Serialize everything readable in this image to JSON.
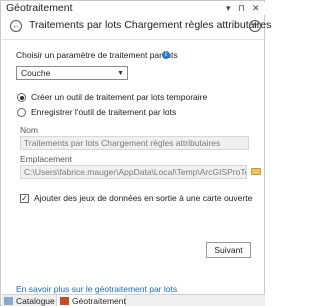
{
  "window": {
    "title": "Géotraitement",
    "controls": {
      "pin": "▾",
      "autohide": "⊓",
      "close": "✕"
    }
  },
  "header": {
    "back_icon": "←",
    "title": "Traitements par lots Chargement règles attributaires",
    "add_icon": "+"
  },
  "form": {
    "param_label": "Choisir un paramètre de traitement par lots",
    "info_icon": "i",
    "param_value": "Couche",
    "radio_temp": "Créer un outil de traitement par lots temporaire",
    "radio_save": "Enregistrer l'outil de traitement par lots",
    "name_label": "Nom",
    "name_value": "Traitements par lots Chargement règles attributaires",
    "location_label": "Emplacement",
    "location_value": "C:\\Users\\fabrice.mauger\\AppData\\Local\\Temp\\ArcGISProTemp218",
    "add_outputs_label": "Ajouter des jeux de données en sortie à une carte ouverte",
    "add_outputs_checked": true,
    "next_button": "Suivant"
  },
  "footer": {
    "learn_more_link": "En savoir plus sur le géotraitement par lots"
  },
  "tabs": [
    {
      "label": "Catalogue",
      "active": false
    },
    {
      "label": "Géotraitement",
      "active": true
    }
  ]
}
